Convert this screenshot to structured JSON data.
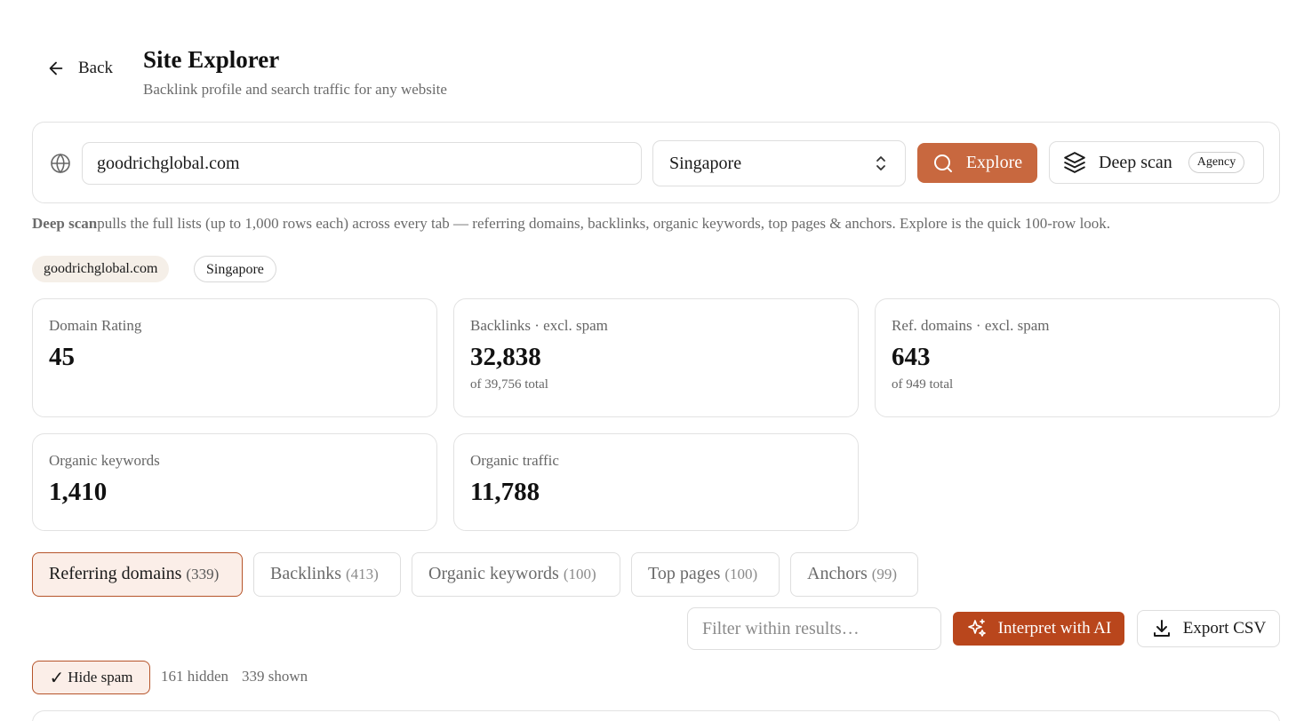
{
  "header": {
    "back_label": "Back",
    "title": "Site Explorer",
    "subtitle": "Backlink profile and search traffic for any website"
  },
  "search": {
    "domain_value": "goodrichglobal.com",
    "country_value": "Singapore",
    "explore_label": "Explore",
    "deepscan_label": "Deep scan",
    "deepscan_badge": "Agency"
  },
  "hint": {
    "bold": "Deep scan",
    "text": "pulls the full lists (up to 1,000 rows each) across every tab — referring domains, backlinks, organic keywords, top pages & anchors. Explore is the quick 100-row look."
  },
  "chips": {
    "domain": "goodrichglobal.com",
    "country": "Singapore"
  },
  "stats": {
    "domain_rating": {
      "label": "Domain Rating",
      "value": "45"
    },
    "backlinks": {
      "label": "Backlinks · excl. spam",
      "value": "32,838",
      "sub": "of 39,756 total"
    },
    "ref_domains": {
      "label": "Ref. domains · excl. spam",
      "value": "643",
      "sub": "of 949 total"
    },
    "organic_keywords": {
      "label": "Organic keywords",
      "value": "1,410"
    },
    "organic_traffic": {
      "label": "Organic traffic",
      "value": "11,788"
    }
  },
  "tabs": [
    {
      "label": "Referring domains",
      "count": "(339)"
    },
    {
      "label": "Backlinks",
      "count": "(413)"
    },
    {
      "label": "Organic keywords",
      "count": "(100)"
    },
    {
      "label": "Top pages",
      "count": "(100)"
    },
    {
      "label": "Anchors",
      "count": "(99)"
    }
  ],
  "toolbar": {
    "filter_placeholder": "Filter within results…",
    "ai_label": "Interpret with AI",
    "export_label": "Export CSV",
    "hide_spam_label": "Hide spam",
    "hide_spam_check": "✓",
    "hidden_count": "161 hidden",
    "shown_count": "339 shown"
  },
  "colors": {
    "accent": "#c8683f",
    "accent_dark": "#b9461c",
    "active_tab_bg": "#fbeee8",
    "chip_bg": "#f5efe8"
  },
  "icons": {
    "back": "arrow-left-icon",
    "globe": "globe-icon",
    "select": "chevron-up-down-icon",
    "explore": "search-icon",
    "deepscan": "layers-icon",
    "ai": "sparkles-icon",
    "export": "download-icon"
  }
}
